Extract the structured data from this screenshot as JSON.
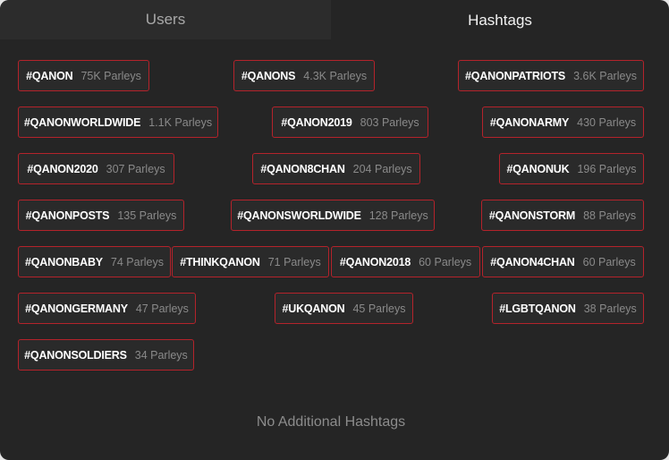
{
  "tabs": {
    "users": "Users",
    "hashtags": "Hashtags"
  },
  "hashtags": [
    {
      "tag": "#QANON",
      "count": "75K Parleys"
    },
    {
      "tag": "#QANONS",
      "count": "4.3K Parleys"
    },
    {
      "tag": "#QANONPATRIOTS",
      "count": "3.6K Parleys"
    },
    {
      "tag": "#QANONWORLDWIDE",
      "count": "1.1K Parleys"
    },
    {
      "tag": "#QANON2019",
      "count": "803 Parleys"
    },
    {
      "tag": "#QANONARMY",
      "count": "430 Parleys"
    },
    {
      "tag": "#QANON2020",
      "count": "307 Parleys"
    },
    {
      "tag": "#QANON8CHAN",
      "count": "204 Parleys"
    },
    {
      "tag": "#QANONUK",
      "count": "196 Parleys"
    },
    {
      "tag": "#QANONPOSTS",
      "count": "135 Parleys"
    },
    {
      "tag": "#QANONSWORLDWIDE",
      "count": "128 Parleys"
    },
    {
      "tag": "#QANONSTORM",
      "count": "88 Parleys"
    },
    {
      "tag": "#QANONBABY",
      "count": "74 Parleys"
    },
    {
      "tag": "#THINKQANON",
      "count": "71 Parleys"
    },
    {
      "tag": "#QANON2018",
      "count": "60 Parleys"
    },
    {
      "tag": "#QANON4CHAN",
      "count": "60 Parleys"
    },
    {
      "tag": "#QANONGERMANY",
      "count": "47 Parleys"
    },
    {
      "tag": "#UKQANON",
      "count": "45 Parleys"
    },
    {
      "tag": "#LGBTQANON",
      "count": "38 Parleys"
    },
    {
      "tag": "#QANONSOLDIERS",
      "count": "34 Parleys"
    }
  ],
  "empty_message": "No Additional Hashtags",
  "colors": {
    "panel_bg": "#252525",
    "chip_border": "#b4232b",
    "chip_text": "#ffffff",
    "chip_count": "#8a8a8a"
  }
}
